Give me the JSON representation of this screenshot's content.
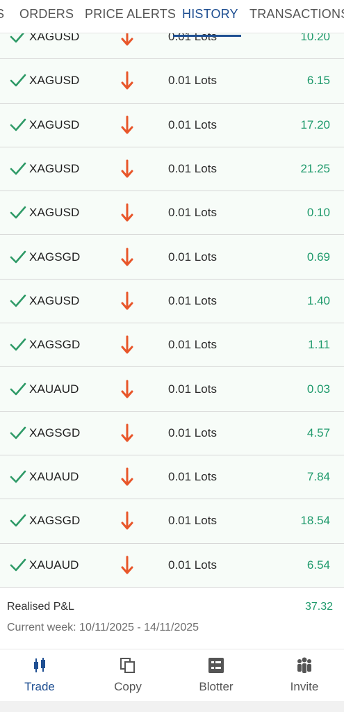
{
  "tabs": [
    {
      "label": "S"
    },
    {
      "label": "ORDERS"
    },
    {
      "label": "PRICE ALERTS"
    },
    {
      "label": "HISTORY"
    },
    {
      "label": "TRANSACTIONS"
    }
  ],
  "active_tab": "HISTORY",
  "colors": {
    "accent": "#1f4f92",
    "profit": "#1f9a6c",
    "check": "#2e9a67",
    "sell_arrow": "#e8562a"
  },
  "history": [
    {
      "symbol": "XAGUSD",
      "volume": "0.01 Lots",
      "pl": "10.20",
      "status_icon": "check-icon",
      "direction_icon": "arrow-down-icon"
    },
    {
      "symbol": "XAGUSD",
      "volume": "0.01 Lots",
      "pl": "6.15",
      "status_icon": "check-icon",
      "direction_icon": "arrow-down-icon"
    },
    {
      "symbol": "XAGUSD",
      "volume": "0.01 Lots",
      "pl": "17.20",
      "status_icon": "check-icon",
      "direction_icon": "arrow-down-icon"
    },
    {
      "symbol": "XAGUSD",
      "volume": "0.01 Lots",
      "pl": "21.25",
      "status_icon": "check-icon",
      "direction_icon": "arrow-down-icon"
    },
    {
      "symbol": "XAGUSD",
      "volume": "0.01 Lots",
      "pl": "0.10",
      "status_icon": "check-icon",
      "direction_icon": "arrow-down-icon"
    },
    {
      "symbol": "XAGSGD",
      "volume": "0.01 Lots",
      "pl": "0.69",
      "status_icon": "check-icon",
      "direction_icon": "arrow-down-icon"
    },
    {
      "symbol": "XAGUSD",
      "volume": "0.01 Lots",
      "pl": "1.40",
      "status_icon": "check-icon",
      "direction_icon": "arrow-down-icon"
    },
    {
      "symbol": "XAGSGD",
      "volume": "0.01 Lots",
      "pl": "1.11",
      "status_icon": "check-icon",
      "direction_icon": "arrow-down-icon"
    },
    {
      "symbol": "XAUAUD",
      "volume": "0.01 Lots",
      "pl": "0.03",
      "status_icon": "check-icon",
      "direction_icon": "arrow-down-icon"
    },
    {
      "symbol": "XAGSGD",
      "volume": "0.01 Lots",
      "pl": "4.57",
      "status_icon": "check-icon",
      "direction_icon": "arrow-down-icon"
    },
    {
      "symbol": "XAUAUD",
      "volume": "0.01 Lots",
      "pl": "7.84",
      "status_icon": "check-icon",
      "direction_icon": "arrow-down-icon"
    },
    {
      "symbol": "XAGSGD",
      "volume": "0.01 Lots",
      "pl": "18.54",
      "status_icon": "check-icon",
      "direction_icon": "arrow-down-icon"
    },
    {
      "symbol": "XAUAUD",
      "volume": "0.01 Lots",
      "pl": "6.54",
      "status_icon": "check-icon",
      "direction_icon": "arrow-down-icon"
    }
  ],
  "summary": {
    "realised_label": "Realised P&L",
    "realised_value": "37.32",
    "period": "Current week: 10/11/2025 - 14/11/2025"
  },
  "bottom_nav": [
    {
      "label": "Trade",
      "icon": "candlestick-icon",
      "active": true
    },
    {
      "label": "Copy",
      "icon": "copy-icon",
      "active": false
    },
    {
      "label": "Blotter",
      "icon": "blotter-icon",
      "active": false
    },
    {
      "label": "Invite",
      "icon": "people-icon",
      "active": false
    }
  ]
}
